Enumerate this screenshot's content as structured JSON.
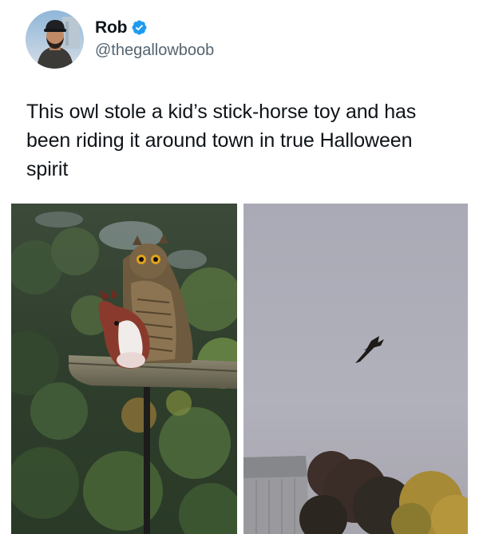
{
  "author": {
    "display_name": "Rob",
    "handle": "@thegallowboob",
    "verified": true,
    "avatar_icon": "profile-photo-man-in-cap",
    "badge_icon": "verified-check-badge",
    "badge_color": "#1d9bf0"
  },
  "tweet": {
    "text": "This owl stole a kid’s stick-horse toy and has been riding it around town in true Halloween spirit"
  },
  "media": {
    "count": 2,
    "images": [
      {
        "subject": "owl-perched-with-stick-horse-toy"
      },
      {
        "subject": "owl-flying-in-grey-sky"
      }
    ]
  },
  "colors": {
    "text_primary": "#0f1419",
    "text_secondary": "#536471",
    "background": "#ffffff"
  }
}
